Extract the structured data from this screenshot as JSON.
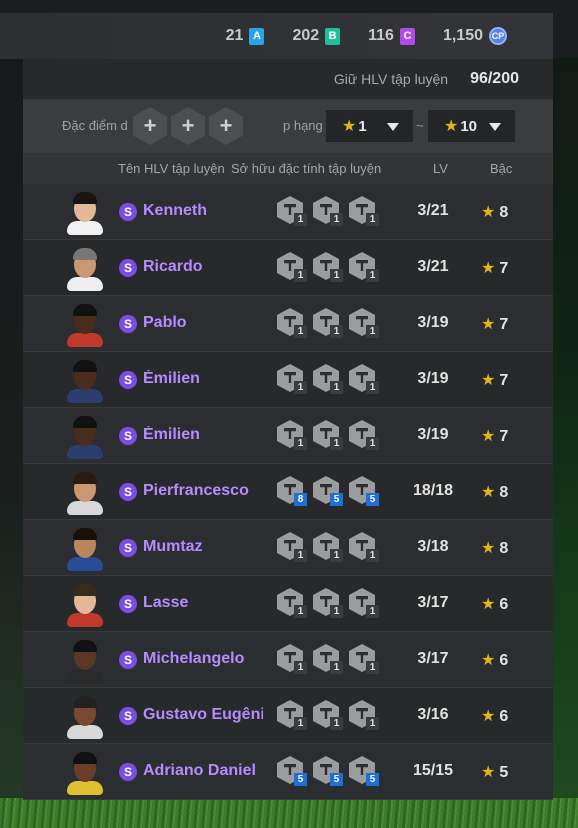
{
  "currencies": [
    {
      "value": "21",
      "badge": "A",
      "color": "#2aa4e8"
    },
    {
      "value": "202",
      "badge": "B",
      "color": "#1fbf9a"
    },
    {
      "value": "116",
      "badge": "C",
      "color": "#b04be8"
    },
    {
      "value": "1,150",
      "badge": "CP",
      "color": "#5a7fe0"
    }
  ],
  "holding": {
    "label": "Giữ HLV tập luyện",
    "value": "96/200"
  },
  "filter": {
    "trait_label": "Đặc điểm d",
    "add_symbol": "+",
    "sort_label": "p hạng",
    "min_rank": "1",
    "max_rank": "10",
    "range_sep": "~",
    "star": "★"
  },
  "columns": {
    "name": "Tên HLV tập luyện",
    "traits": "Sở hữu đặc tính tập luyện",
    "lv": "LV",
    "rank": "Bậc"
  },
  "badge_letter": "S",
  "rows": [
    {
      "name": "Kenneth",
      "traits": [
        "1",
        "1",
        "1"
      ],
      "lv": "3/21",
      "rank": "8",
      "skin": "#e2b897",
      "hair": "#1a1410",
      "shirt": "#f2f2f2"
    },
    {
      "name": "Ricardo",
      "traits": [
        "1",
        "1",
        "1"
      ],
      "lv": "3/21",
      "rank": "7",
      "skin": "#c99774",
      "hair": "#777",
      "shirt": "#efefef"
    },
    {
      "name": "Pablo",
      "traits": [
        "1",
        "1",
        "1"
      ],
      "lv": "3/19",
      "rank": "7",
      "skin": "#4a2c1c",
      "hair": "#111",
      "shirt": "#c0392b"
    },
    {
      "name": "Émilien",
      "traits": [
        "1",
        "1",
        "1"
      ],
      "lv": "3/19",
      "rank": "7",
      "skin": "#4a2c1c",
      "hair": "#111",
      "shirt": "#2c3e70"
    },
    {
      "name": "Émilien",
      "traits": [
        "1",
        "1",
        "1"
      ],
      "lv": "3/19",
      "rank": "7",
      "skin": "#4a2c1c",
      "hair": "#111",
      "shirt": "#2c3e70"
    },
    {
      "name": "Pierfrancesco",
      "traits": [
        "8",
        "5",
        "5"
      ],
      "lv": "18/18",
      "rank": "8",
      "skin": "#c99774",
      "hair": "#2a1a10",
      "shirt": "#d8d8d8"
    },
    {
      "name": "Mumtaz",
      "traits": [
        "1",
        "1",
        "1"
      ],
      "lv": "3/18",
      "rank": "8",
      "skin": "#b8865f",
      "hair": "#1a1008",
      "shirt": "#2a4a9a"
    },
    {
      "name": "Lasse",
      "traits": [
        "1",
        "1",
        "1"
      ],
      "lv": "3/17",
      "rank": "6",
      "skin": "#e2b897",
      "hair": "#3a2a1a",
      "shirt": "#c0392b"
    },
    {
      "name": "Michelangelo",
      "traits": [
        "1",
        "1",
        "1"
      ],
      "lv": "3/17",
      "rank": "6",
      "skin": "#5a3624",
      "hair": "#111",
      "shirt": "#2a2a2a"
    },
    {
      "name": "Gustavo Eugênio",
      "traits": [
        "1",
        "1",
        "1"
      ],
      "lv": "3/16",
      "rank": "6",
      "skin": "#7a4a30",
      "hair": "#222",
      "shirt": "#d8d8d8"
    },
    {
      "name": "Adriano Daniel",
      "traits": [
        "5",
        "5",
        "5"
      ],
      "lv": "15/15",
      "rank": "5",
      "skin": "#6a3e28",
      "hair": "#111",
      "shirt": "#e0c030"
    }
  ]
}
